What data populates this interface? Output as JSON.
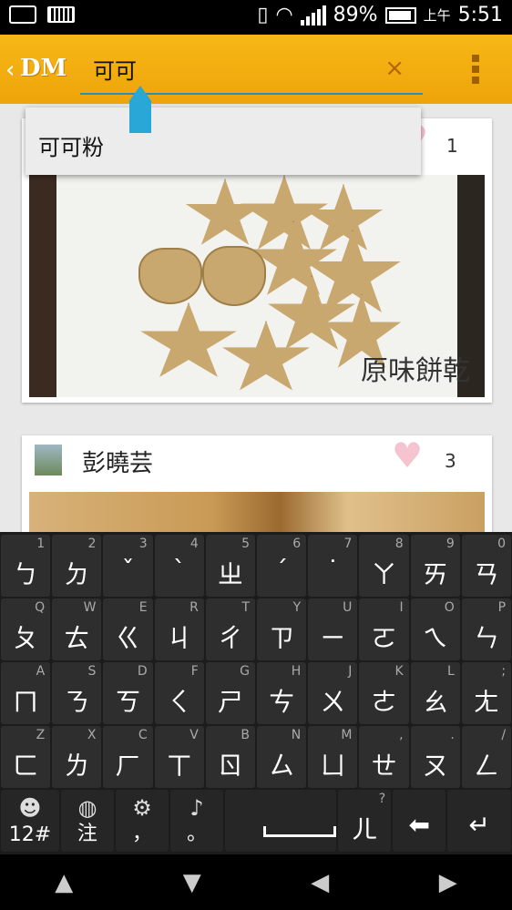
{
  "status": {
    "battery": "89%",
    "ampm": "上午",
    "time": "5:51"
  },
  "search": {
    "value": "可可",
    "clear_glyph": "×"
  },
  "suggestions": [
    "可可粉"
  ],
  "cards": [
    {
      "likes": "1",
      "caption": "原味餅乾"
    },
    {
      "author": "彭曉芸",
      "likes": "3"
    }
  ],
  "keyboard": {
    "rows": [
      [
        [
          "ㄅ",
          "1"
        ],
        [
          "ㄉ",
          "2"
        ],
        [
          "ˇ",
          "3"
        ],
        [
          "ˋ",
          "4"
        ],
        [
          "ㄓ",
          "5"
        ],
        [
          "ˊ",
          "6"
        ],
        [
          "˙",
          "7"
        ],
        [
          "ㄚ",
          "8"
        ],
        [
          "ㄞ",
          "9"
        ],
        [
          "ㄢ",
          "0"
        ]
      ],
      [
        [
          "ㄆ",
          "Q"
        ],
        [
          "ㄊ",
          "W"
        ],
        [
          "ㄍ",
          "E"
        ],
        [
          "ㄐ",
          "R"
        ],
        [
          "ㄔ",
          "T"
        ],
        [
          "ㄗ",
          "Y"
        ],
        [
          "ㄧ",
          "U"
        ],
        [
          "ㄛ",
          "I"
        ],
        [
          "ㄟ",
          "O"
        ],
        [
          "ㄣ",
          "P"
        ]
      ],
      [
        [
          "ㄇ",
          "A"
        ],
        [
          "ㄋ",
          "S"
        ],
        [
          "ㄎ",
          "D"
        ],
        [
          "ㄑ",
          "F"
        ],
        [
          "ㄕ",
          "G"
        ],
        [
          "ㄘ",
          "H"
        ],
        [
          "ㄨ",
          "J"
        ],
        [
          "ㄜ",
          "K"
        ],
        [
          "ㄠ",
          "L"
        ],
        [
          "ㄤ",
          ";"
        ]
      ],
      [
        [
          "ㄈ",
          "Z"
        ],
        [
          "ㄌ",
          "X"
        ],
        [
          "ㄏ",
          "C"
        ],
        [
          "ㄒ",
          "V"
        ],
        [
          "ㄖ",
          "B"
        ],
        [
          "ㄙ",
          "N"
        ],
        [
          "ㄩ",
          "M"
        ],
        [
          "ㄝ",
          ","
        ],
        [
          "ㄡ",
          "."
        ],
        [
          "ㄥ",
          "/"
        ]
      ]
    ],
    "bottom": {
      "emoji_label": "12#",
      "lang_label": "注",
      "settings_label": "，",
      "mic_label": "。",
      "er_key": "ㄦ",
      "er_hint": "?"
    }
  }
}
